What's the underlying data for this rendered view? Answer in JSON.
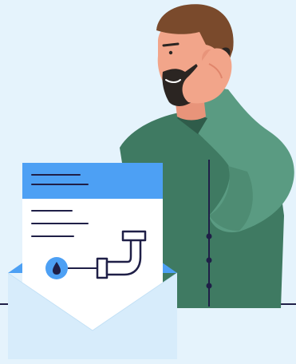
{
  "illustration": {
    "subject": "person-on-phone-with-plumbing-letter",
    "colors": {
      "background": "#e5f3fc",
      "shirt": "#3f7a62",
      "shirt_light": "#5a9b82",
      "shirt_dark": "#2f5c4a",
      "skin": "#f2a58a",
      "hair": "#7a4a2c",
      "beard": "#2b2522",
      "phone": "#2b2522",
      "outline": "#1f1f47",
      "doc_header": "#4da0f4",
      "doc_paper": "#ffffff",
      "envelope_front": "#d7ecfb",
      "envelope_back": "#4da0f4",
      "water_drop_circle": "#4da0f4"
    },
    "icons": [
      "water-drop-icon",
      "pipe-icon",
      "document-lines-icon",
      "envelope-icon",
      "phone-icon"
    ]
  }
}
